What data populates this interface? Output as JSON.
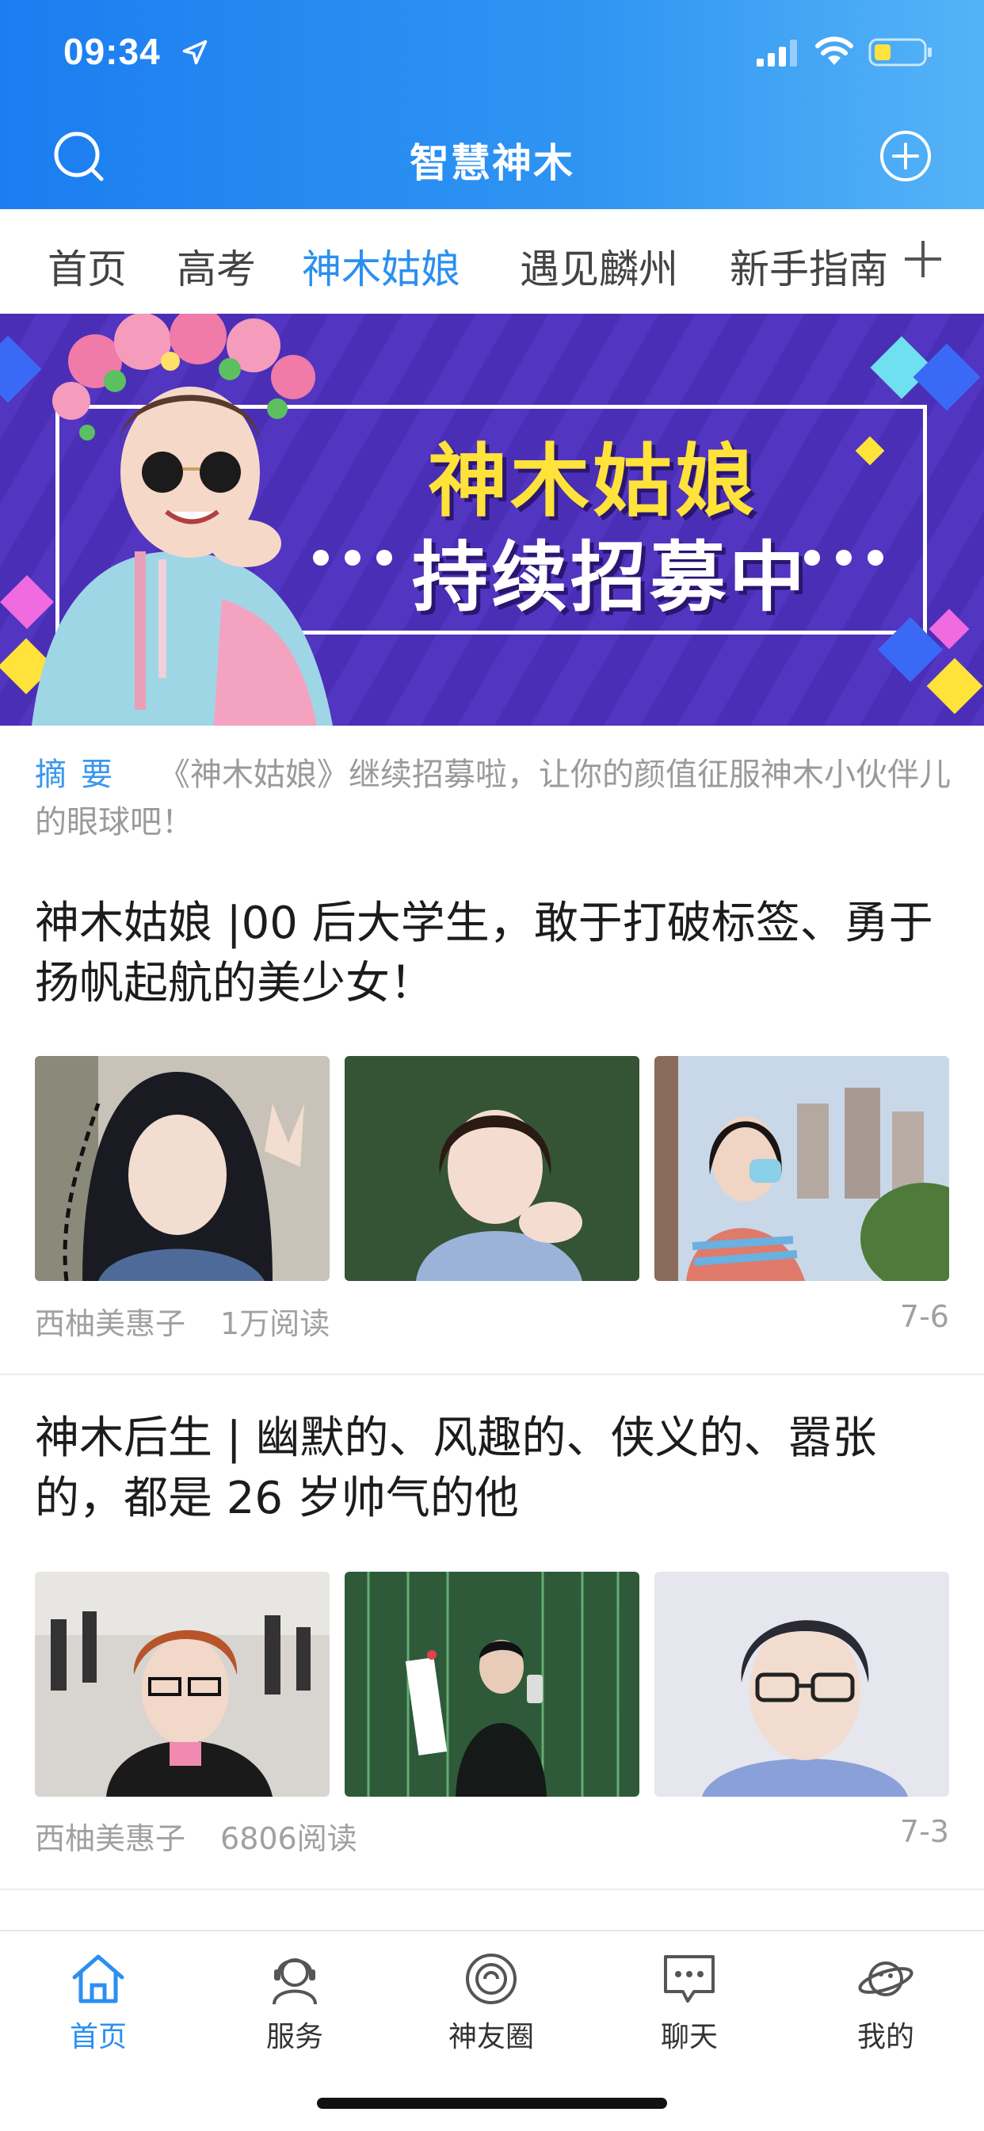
{
  "status_bar": {
    "time": "09:34"
  },
  "header": {
    "title": "智慧神木",
    "search_icon": "search-icon",
    "add_icon": "plus-circle-icon",
    "accent_color": "#2b8ff0"
  },
  "tabs": [
    {
      "label": "首页",
      "active": false
    },
    {
      "label": "高考",
      "active": false
    },
    {
      "label": "神木姑娘",
      "active": true
    },
    {
      "label": "遇见麟州",
      "active": false
    },
    {
      "label": "新手指南",
      "active": false
    }
  ],
  "banner": {
    "title_line1": "神木姑娘",
    "title_line2": "持续招募中"
  },
  "summary": {
    "label": "摘要",
    "text": "《神木姑娘》继续招募啦，让你的颜值征服神木小伙伴儿的眼球吧！"
  },
  "articles": [
    {
      "title": "神木姑娘 |00 后大学生，敢于打破标签、勇于扬帆起航的美少女！",
      "author": "西柚美惠子",
      "reads": "1万阅读",
      "date": "7-6"
    },
    {
      "title": "神木后生 | 幽默的、风趣的、侠义的、嚣张的，都是 26 岁帅气的他",
      "author": "西柚美惠子",
      "reads": "6806阅读",
      "date": "7-3"
    }
  ],
  "bottom_nav": [
    {
      "label": "首页",
      "icon": "home-icon",
      "active": true
    },
    {
      "label": "服务",
      "icon": "service-icon",
      "active": false
    },
    {
      "label": "神友圈",
      "icon": "circle-icon",
      "active": false
    },
    {
      "label": "聊天",
      "icon": "chat-icon",
      "active": false
    },
    {
      "label": "我的",
      "icon": "planet-icon",
      "active": false
    }
  ]
}
